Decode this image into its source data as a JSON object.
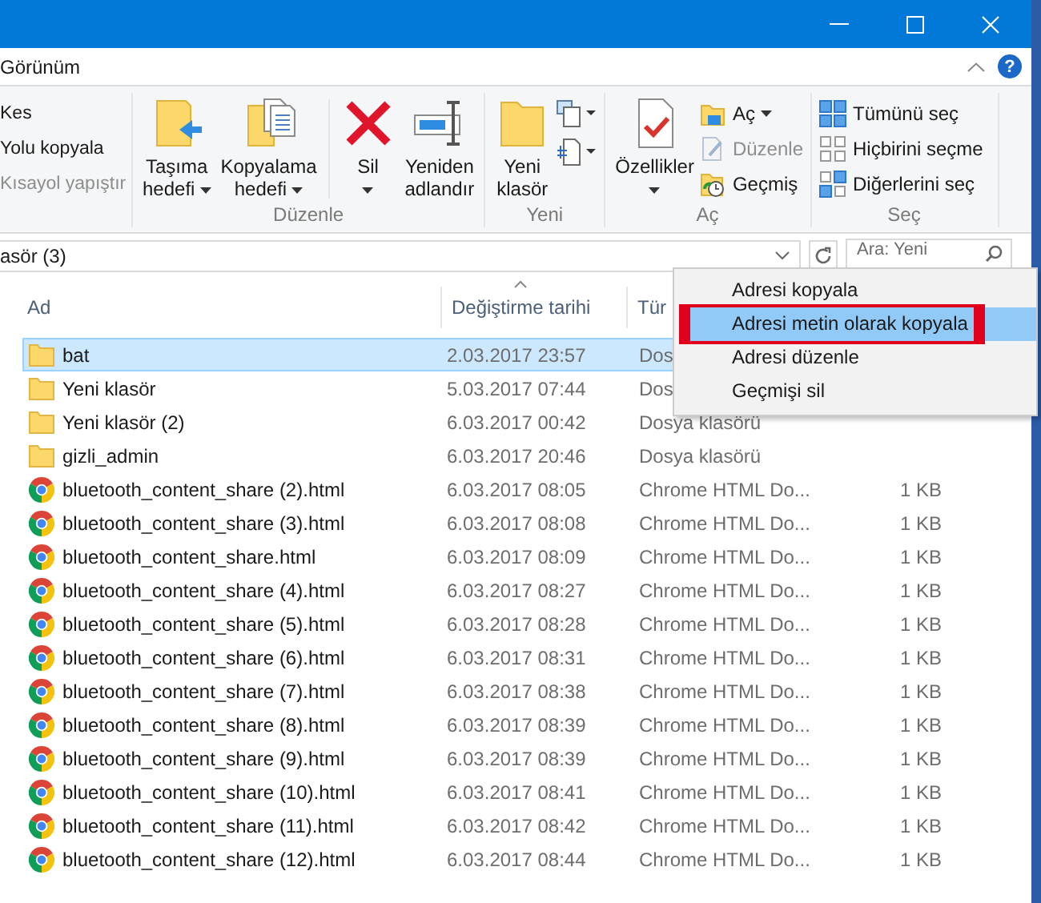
{
  "ribbon_tab": {
    "label": "Görünüm"
  },
  "help_button": {
    "label": "?"
  },
  "ribbon": {
    "groups": [
      {
        "items": [
          {
            "label": "Kes",
            "disabled": false
          },
          {
            "label": "Yolu kopyala",
            "disabled": false
          },
          {
            "label": "Kısayol yapıştır",
            "disabled": true
          }
        ]
      },
      {
        "label": "Düzenle",
        "items": [
          {
            "label": "Taşıma hedefi",
            "dropdown": true
          },
          {
            "label": "Kopyalama hedefi",
            "dropdown": true
          },
          {
            "label": "Sil",
            "dropdown": true
          },
          {
            "label": "Yeniden adlandır",
            "dropdown": false
          }
        ]
      },
      {
        "label": "Yeni",
        "items": [
          {
            "label": "Yeni klasör",
            "dropdown": false
          }
        ]
      },
      {
        "label": "Aç",
        "items": [
          {
            "label": "Özellikler",
            "dropdown": true
          }
        ],
        "small_items": [
          {
            "label": "Aç",
            "dropdown": true,
            "disabled": false
          },
          {
            "label": "Düzenle",
            "dropdown": false,
            "disabled": true
          },
          {
            "label": "Geçmiş",
            "dropdown": false,
            "disabled": false
          }
        ]
      },
      {
        "label": "Seç",
        "items": [
          {
            "label": "Tümünü seç"
          },
          {
            "label": "Hiçbirini seçme"
          },
          {
            "label": "Diğerlerini seç"
          }
        ]
      }
    ]
  },
  "address_bar": {
    "path": "asör (3)",
    "search_placeholder": "Ara: Yeni"
  },
  "file_list": {
    "columns": [
      {
        "label": "Ad",
        "sorted": false
      },
      {
        "label": "Değiştirme tarihi",
        "sorted": true
      },
      {
        "label": "Tür",
        "sorted": false
      }
    ],
    "rows": [
      {
        "kind": "folder",
        "name": "bat",
        "modified": "2.03.2017 23:57",
        "type": "Dos",
        "selected": true
      },
      {
        "kind": "folder",
        "name": "Yeni klasör",
        "modified": "5.03.2017 07:44",
        "type": "Dos",
        "selected": false
      },
      {
        "kind": "folder",
        "name": "Yeni klasör (2)",
        "modified": "6.03.2017 00:42",
        "type": "Dosya klasörü",
        "selected": false
      },
      {
        "kind": "folder",
        "name": "gizli_admin",
        "modified": "6.03.2017 20:46",
        "type": "Dosya klasörü",
        "selected": false
      },
      {
        "kind": "html",
        "name": "bluetooth_content_share (2).html",
        "modified": "6.03.2017 08:05",
        "type": "Chrome HTML Do...",
        "size": "1 KB",
        "selected": false
      },
      {
        "kind": "html",
        "name": "bluetooth_content_share (3).html",
        "modified": "6.03.2017 08:08",
        "type": "Chrome HTML Do...",
        "size": "1 KB",
        "selected": false
      },
      {
        "kind": "html",
        "name": "bluetooth_content_share.html",
        "modified": "6.03.2017 08:09",
        "type": "Chrome HTML Do...",
        "size": "1 KB",
        "selected": false
      },
      {
        "kind": "html",
        "name": "bluetooth_content_share (4).html",
        "modified": "6.03.2017 08:27",
        "type": "Chrome HTML Do...",
        "size": "1 KB",
        "selected": false
      },
      {
        "kind": "html",
        "name": "bluetooth_content_share (5).html",
        "modified": "6.03.2017 08:28",
        "type": "Chrome HTML Do...",
        "size": "1 KB",
        "selected": false
      },
      {
        "kind": "html",
        "name": "bluetooth_content_share (6).html",
        "modified": "6.03.2017 08:31",
        "type": "Chrome HTML Do...",
        "size": "1 KB",
        "selected": false
      },
      {
        "kind": "html",
        "name": "bluetooth_content_share (7).html",
        "modified": "6.03.2017 08:38",
        "type": "Chrome HTML Do...",
        "size": "1 KB",
        "selected": false
      },
      {
        "kind": "html",
        "name": "bluetooth_content_share (8).html",
        "modified": "6.03.2017 08:39",
        "type": "Chrome HTML Do...",
        "size": "1 KB",
        "selected": false
      },
      {
        "kind": "html",
        "name": "bluetooth_content_share (9).html",
        "modified": "6.03.2017 08:39",
        "type": "Chrome HTML Do...",
        "size": "1 KB",
        "selected": false
      },
      {
        "kind": "html",
        "name": "bluetooth_content_share (10).html",
        "modified": "6.03.2017 08:41",
        "type": "Chrome HTML Do...",
        "size": "1 KB",
        "selected": false
      },
      {
        "kind": "html",
        "name": "bluetooth_content_share (11).html",
        "modified": "6.03.2017 08:42",
        "type": "Chrome HTML Do...",
        "size": "1 KB",
        "selected": false
      },
      {
        "kind": "html",
        "name": "bluetooth_content_share (12).html",
        "modified": "6.03.2017 08:44",
        "type": "Chrome HTML Do...",
        "size": "1 KB",
        "selected": false
      }
    ]
  },
  "context_menu": {
    "items": [
      {
        "label": "Adresi kopyala",
        "selected": false,
        "annotated": false
      },
      {
        "label": "Adresi metin olarak kopyala",
        "selected": true,
        "annotated": true
      },
      {
        "label": "Adresi düzenle",
        "selected": false,
        "annotated": false
      },
      {
        "label": "Geçmişi sil",
        "selected": false,
        "annotated": false
      }
    ]
  }
}
